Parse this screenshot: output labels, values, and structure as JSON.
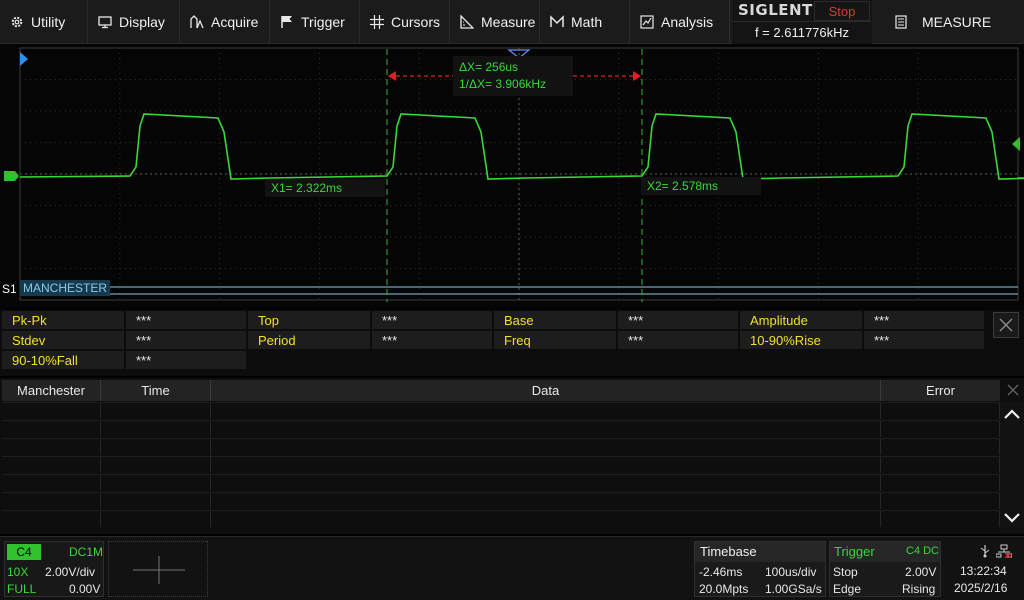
{
  "menu": {
    "items": [
      {
        "label": "Utility",
        "icon": "gear-icon"
      },
      {
        "label": "Display",
        "icon": "monitor-icon"
      },
      {
        "label": "Acquire",
        "icon": "acquire-icon"
      },
      {
        "label": "Trigger",
        "icon": "flag-icon"
      },
      {
        "label": "Cursors",
        "icon": "crosshair-icon"
      },
      {
        "label": "Measure",
        "icon": "measure-icon"
      },
      {
        "label": "Math",
        "icon": "math-icon"
      },
      {
        "label": "Analysis",
        "icon": "analysis-icon"
      }
    ],
    "brand": "SIGLENT",
    "run_state": "Stop",
    "frequency": "f = 2.611776kHz",
    "side_label": "MEASURE"
  },
  "colors": {
    "trace": "#39d839",
    "cursor": "#2fb82f",
    "delta_arrow": "#e02020",
    "measure_name": "#f0e030",
    "trigger_marker": "#2fc22f",
    "level_marker": "#2f8fe8",
    "decode_line": "#8ec8e8"
  },
  "cursors": {
    "x1": "X1= 2.322ms",
    "x2": "X2= 2.578ms",
    "delta_x": "ΔX= 256us",
    "inv_delta_x": "1/ΔX= 3.906kHz"
  },
  "decode": {
    "row_label": "S1",
    "protocol": "MANCHESTER"
  },
  "measurements": {
    "rows": [
      [
        {
          "name": "Pk-Pk",
          "value": "***"
        },
        {
          "name": "Top",
          "value": "***"
        },
        {
          "name": "Base",
          "value": "***"
        },
        {
          "name": "Amplitude",
          "value": "***"
        }
      ],
      [
        {
          "name": "Stdev",
          "value": "***"
        },
        {
          "name": "Period",
          "value": "***"
        },
        {
          "name": "Freq",
          "value": "***"
        },
        {
          "name": "10-90%Rise",
          "value": "***"
        }
      ],
      [
        {
          "name": "90-10%Fall",
          "value": "***"
        }
      ]
    ]
  },
  "decode_table": {
    "headers": [
      "Manchester",
      "Time",
      "Data",
      "Error"
    ]
  },
  "channel": {
    "name": "C4",
    "coupling": "DC1M",
    "probe": "10X",
    "scale": "2.00V/div",
    "bandwidth": "FULL",
    "offset": "0.00V"
  },
  "timebase": {
    "title": "Timebase",
    "delay": "-2.46ms",
    "scale": "100us/div",
    "memory": "20.0Mpts",
    "sample_rate": "1.00GSa/s"
  },
  "trigger": {
    "title": "Trigger",
    "source": "C4 DC",
    "mode": "Stop",
    "level": "2.00V",
    "type": "Edge",
    "slope": "Rising"
  },
  "clock": {
    "time": "13:22:34",
    "date": "2025/2/16"
  }
}
